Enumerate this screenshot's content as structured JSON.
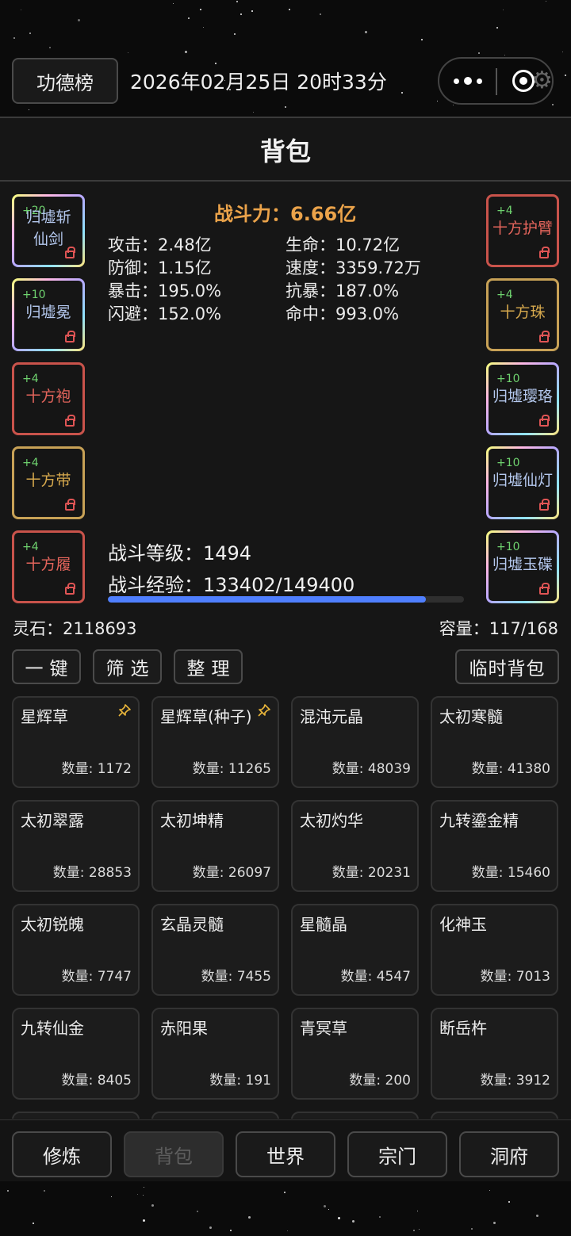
{
  "header": {
    "merit_button": "功德榜",
    "datetime": "2026年02月25日 20时33分"
  },
  "page_title": "背包",
  "combat_power": {
    "label": "战斗力：",
    "value": "6.66亿"
  },
  "stats": [
    {
      "label": "攻击：",
      "value": "2.48亿"
    },
    {
      "label": "生命：",
      "value": "10.72亿"
    },
    {
      "label": "防御：",
      "value": "1.15亿"
    },
    {
      "label": "速度：",
      "value": "3359.72万"
    },
    {
      "label": "暴击：",
      "value": "195.0%"
    },
    {
      "label": "抗暴：",
      "value": "187.0%"
    },
    {
      "label": "闪避：",
      "value": "152.0%"
    },
    {
      "label": "命中：",
      "value": "993.0%"
    }
  ],
  "equipment_left": [
    {
      "level": "+20",
      "name": "归墟斩仙剑",
      "rarity": "rainbow"
    },
    {
      "level": "+10",
      "name": "归墟冕",
      "rarity": "rainbow"
    },
    {
      "level": "+4",
      "name": "十方袍",
      "rarity": "red"
    },
    {
      "level": "+4",
      "name": "十方带",
      "rarity": "gold"
    },
    {
      "level": "+4",
      "name": "十方履",
      "rarity": "red"
    }
  ],
  "equipment_right": [
    {
      "level": "+4",
      "name": "十方护臂",
      "rarity": "red"
    },
    {
      "level": "+4",
      "name": "十方珠",
      "rarity": "gold"
    },
    {
      "level": "+10",
      "name": "归墟璎珞",
      "rarity": "rainbow"
    },
    {
      "level": "+10",
      "name": "归墟仙灯",
      "rarity": "rainbow"
    },
    {
      "level": "+10",
      "name": "归墟玉碟",
      "rarity": "rainbow"
    }
  ],
  "battle": {
    "level_label": "战斗等级：",
    "level": "1494",
    "exp_label": "战斗经验：",
    "exp": "133402/149400",
    "exp_current": 133402,
    "exp_max": 149400
  },
  "spirit_stone": {
    "label": "灵石：",
    "value": "2118693"
  },
  "capacity": {
    "label": "容量：",
    "value": "117/168"
  },
  "toolbar": {
    "one_key": "一键",
    "filter": "筛选",
    "sort": "整理",
    "temp_bag": "临时背包"
  },
  "items": [
    {
      "name": "星辉草",
      "qty": "数量: 1172",
      "pinned": true
    },
    {
      "name": "星辉草(种子)",
      "qty": "数量: 11265",
      "pinned": true
    },
    {
      "name": "混沌元晶",
      "qty": "数量: 48039",
      "pinned": false
    },
    {
      "name": "太初寒髓",
      "qty": "数量: 41380",
      "pinned": false
    },
    {
      "name": "太初翠露",
      "qty": "数量: 28853",
      "pinned": false
    },
    {
      "name": "太初坤精",
      "qty": "数量: 26097",
      "pinned": false
    },
    {
      "name": "太初灼华",
      "qty": "数量: 20231",
      "pinned": false
    },
    {
      "name": "九转鎏金精",
      "qty": "数量: 15460",
      "pinned": false
    },
    {
      "name": "太初锐魄",
      "qty": "数量: 7747",
      "pinned": false
    },
    {
      "name": "玄晶灵髓",
      "qty": "数量: 7455",
      "pinned": false
    },
    {
      "name": "星髓晶",
      "qty": "数量: 4547",
      "pinned": false
    },
    {
      "name": "化神玉",
      "qty": "数量: 7013",
      "pinned": false
    },
    {
      "name": "九转仙金",
      "qty": "数量: 8405",
      "pinned": false
    },
    {
      "name": "赤阳果",
      "qty": "数量: 191",
      "pinned": false
    },
    {
      "name": "青冥草",
      "qty": "数量: 200",
      "pinned": false
    },
    {
      "name": "断岳杵",
      "qty": "数量: 3912",
      "pinned": false
    }
  ],
  "nav": [
    {
      "label": "修炼",
      "active": false
    },
    {
      "label": "背包",
      "active": true
    },
    {
      "label": "世界",
      "active": false
    },
    {
      "label": "宗门",
      "active": false
    },
    {
      "label": "洞府",
      "active": false
    }
  ],
  "colors": {
    "accent_power": "#eba34a",
    "xp_bar": "#4f7fff",
    "rarity_red": "#c9534b",
    "rarity_gold": "#c7a156",
    "level_green": "#6fd36f",
    "lock_red": "#e05555"
  },
  "icons": {
    "more": "more-dots-icon",
    "target": "target-icon",
    "gear": "gear-icon",
    "lock": "lock-icon",
    "pin": "pin-icon"
  }
}
